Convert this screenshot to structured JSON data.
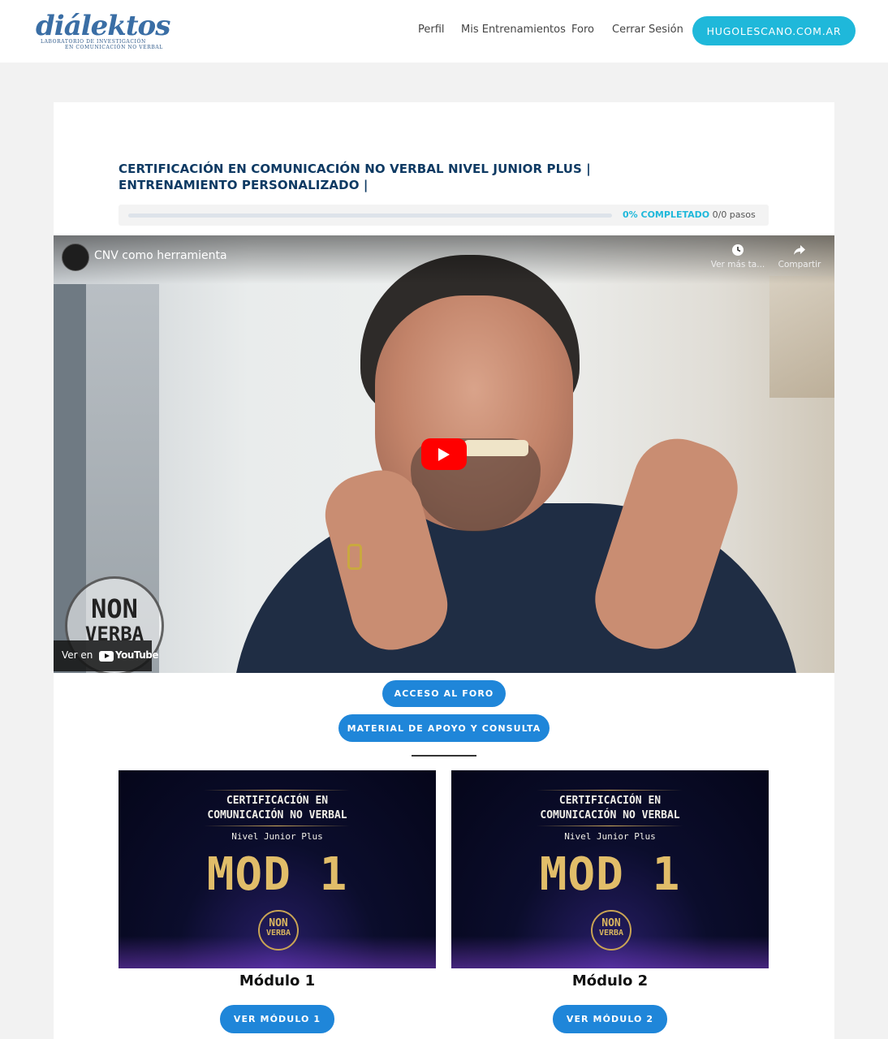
{
  "header": {
    "logo": {
      "name": "diálektos",
      "tagline_1": "LABORATORIO DE INVESTIGACIÓN",
      "tagline_2": "EN COMUNICACIÓN NO VERBAL"
    },
    "nav": [
      "Perfil",
      "Mis Entrenamientos",
      "Foro",
      "Cerrar Sesión"
    ],
    "cta": "HUGOLESCANO.COM.AR"
  },
  "course": {
    "title": "CERTIFICACIÓN EN COMUNICACIÓN NO VERBAL NIVEL JUNIOR PLUS | ENTRENAMIENTO PERSONALIZADO |",
    "progress": {
      "percent": 0,
      "percent_label": "0% COMPLETADO",
      "steps_label": "0/0 pasos"
    }
  },
  "video": {
    "title": "CNV como herramienta",
    "watch_later": "Ver más ta...",
    "share": "Compartir",
    "watch_on": "Ver en",
    "youtube": "YouTube",
    "badge_line1": "NON",
    "badge_line2": "VERBA"
  },
  "buttons": {
    "foro": "ACCESO AL FORO",
    "material": "MATERIAL DE APOYO Y CONSULTA"
  },
  "modules": [
    {
      "thumb_line1": "CERTIFICACIÓN EN",
      "thumb_line2": "COMUNICACIÓN NO VERBAL",
      "thumb_line3": "Nivel Junior Plus",
      "thumb_mod": "MOD 1",
      "thumb_badge1": "NON",
      "thumb_badge2": "VERBA",
      "title": "Módulo 1",
      "button": "VER MÓDULO 1"
    },
    {
      "thumb_line1": "CERTIFICACIÓN EN",
      "thumb_line2": "COMUNICACIÓN NO VERBAL",
      "thumb_line3": "Nivel Junior Plus",
      "thumb_mod": "MOD 1",
      "thumb_badge1": "NON",
      "thumb_badge2": "VERBA",
      "title": "Módulo 2",
      "button": "VER MÓDULO 2"
    }
  ],
  "colors": {
    "accent": "#1fb8da",
    "button": "#1f86d9",
    "title": "#0e3a63",
    "youtube_red": "#ff0000",
    "gold": "#e1bd69"
  },
  "icons": {
    "play": "play-icon",
    "clock": "clock-icon",
    "share": "share-icon",
    "youtube": "youtube-icon"
  }
}
